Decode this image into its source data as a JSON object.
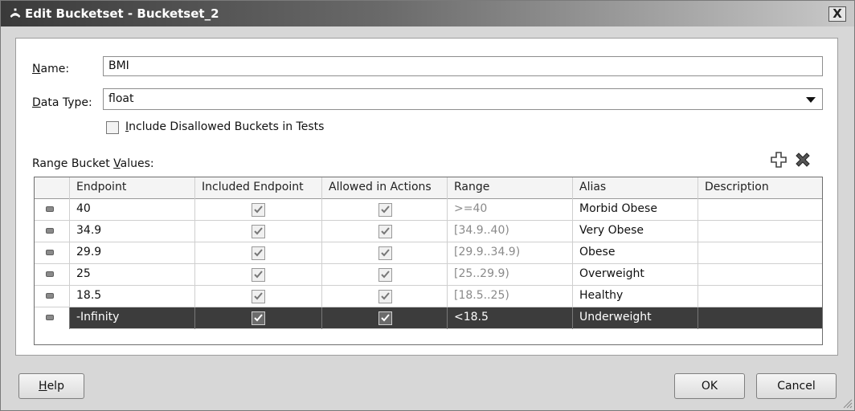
{
  "window": {
    "title": "Edit Bucketset - Bucketset_2",
    "close_label": "X"
  },
  "form": {
    "name_label": "Name:",
    "name_value": "BMI",
    "datatype_label": "Data Type:",
    "datatype_value": "float",
    "include_disallowed_label": "Include Disallowed Buckets in Tests",
    "include_disallowed_checked": false,
    "range_bucket_values_label": "Range Bucket Values:"
  },
  "toolbar": {
    "add_icon": "plus-icon",
    "delete_icon": "x-icon"
  },
  "table": {
    "columns": [
      "Endpoint",
      "Included Endpoint",
      "Allowed in Actions",
      "Range",
      "Alias",
      "Description"
    ],
    "rows": [
      {
        "endpoint": "40",
        "included": true,
        "allowed": true,
        "range": ">=40",
        "alias": "Morbid Obese",
        "description": ""
      },
      {
        "endpoint": "34.9",
        "included": true,
        "allowed": true,
        "range": "[34.9..40)",
        "alias": "Very Obese",
        "description": ""
      },
      {
        "endpoint": "29.9",
        "included": true,
        "allowed": true,
        "range": "[29.9..34.9)",
        "alias": "Obese",
        "description": ""
      },
      {
        "endpoint": "25",
        "included": true,
        "allowed": true,
        "range": "[25..29.9)",
        "alias": "Overweight",
        "description": ""
      },
      {
        "endpoint": "18.5",
        "included": true,
        "allowed": true,
        "range": "[18.5..25)",
        "alias": "Healthy",
        "description": ""
      },
      {
        "endpoint": "-Infinity",
        "included": true,
        "allowed": true,
        "range": "<18.5",
        "alias": "Underweight",
        "description": "",
        "selected": true
      }
    ]
  },
  "buttons": {
    "help": "Help",
    "ok": "OK",
    "cancel": "Cancel"
  }
}
